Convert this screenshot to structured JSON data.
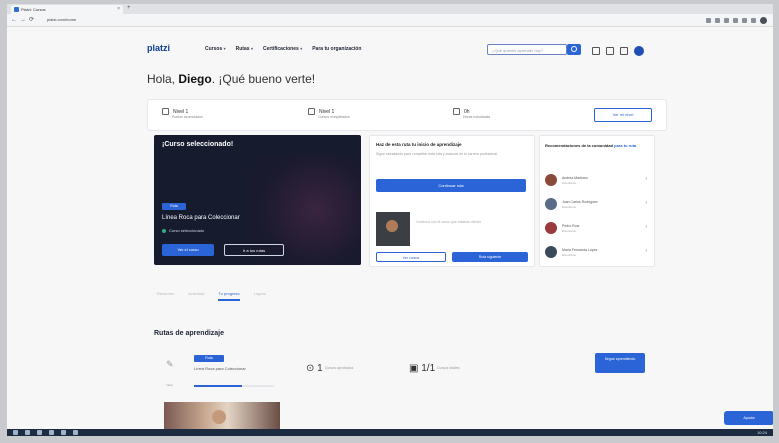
{
  "browser": {
    "tab_title": "Platzi: Cursos",
    "url": "platzi.com/home"
  },
  "header": {
    "logo": "platzi",
    "nav": [
      "Cursos",
      "Rutas",
      "Certificaciones",
      "Para tu organización"
    ],
    "search_placeholder": "¿Qué quieres aprender hoy?"
  },
  "greeting": {
    "prefix": "Hola, ",
    "name": "Diego",
    "suffix": ". ¡Qué bueno verte!"
  },
  "stats": {
    "items": [
      {
        "value": "Nivel 1",
        "label": "Puntos acumulados"
      },
      {
        "value": "Nivel 1",
        "label": "Cursos completados"
      },
      {
        "value": "0h",
        "label": "Horas estudiadas"
      }
    ],
    "button": "Ver mi nivel"
  },
  "hero": {
    "title": "¡Curso seleccionado!",
    "badge": "Ruta",
    "route_name": "Línea Roca para Coleccionar",
    "check": "Curso seleccionado",
    "primary_button": "Ver el curso",
    "secondary_button": "Ir a tus rutas"
  },
  "middle": {
    "title": "Haz de esta ruta tu inicio de aprendizaje",
    "text": "Sigue estudiando para completar esta ruta y avanzar en tu carrera profesional.",
    "cta": "Continuar ruta",
    "card_text": "Continúa con el curso que estabas viendo",
    "outline_button": "Ver cursos",
    "solid_button": "Ruta siguiente"
  },
  "right": {
    "title": "Recomendaciones de la comunidad",
    "title_blue": "para tu ruta",
    "people": [
      {
        "name": "Andrea Martínez",
        "role": "Estudiante"
      },
      {
        "name": "Juan Carlos Rodríguez",
        "role": "Estudiante"
      },
      {
        "name": "Pedro Ruiz",
        "role": "Estudiante"
      },
      {
        "name": "María Fernanda López",
        "role": "Estudiante"
      }
    ]
  },
  "tabs": [
    "Resumen",
    "Actividad",
    "Tu progreso",
    "Logros"
  ],
  "routes": {
    "section_title": "Rutas de aprendizaje",
    "tag": "Ruta",
    "name": "Línea Roca para Coleccionar",
    "progress_label": "Inicio",
    "progress": 0.6,
    "metric1_value": "1",
    "metric1_label": "Cursos aprobados",
    "metric2_value": "1/1",
    "metric2_label": "Cursos totales",
    "go_button": "Seguir aprendiendo"
  },
  "fab": "Ayuda",
  "taskbar": {
    "time": "10:24"
  }
}
